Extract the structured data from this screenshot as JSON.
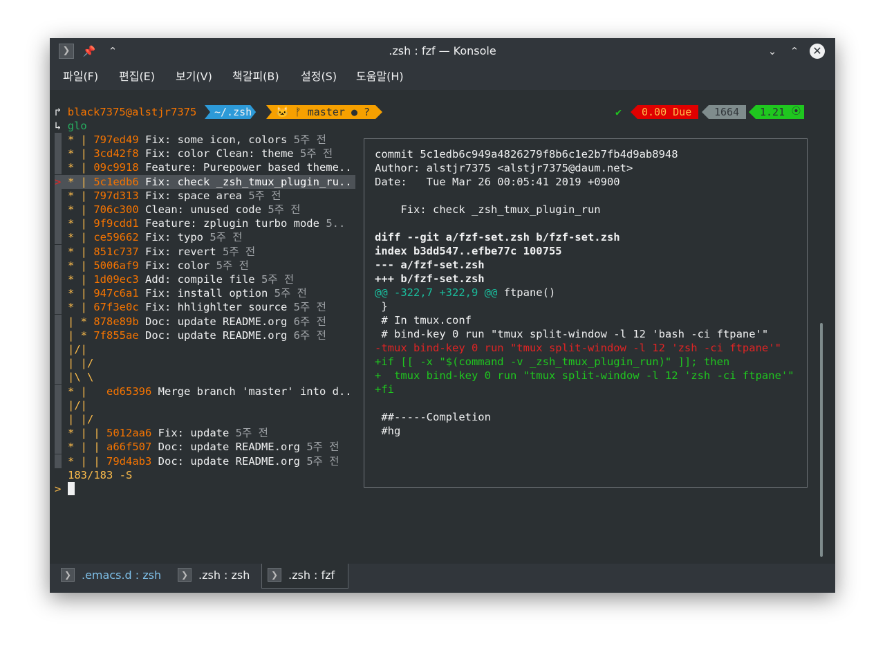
{
  "window": {
    "title": ".zsh : fzf — Konsole"
  },
  "menu": [
    "파일(F)",
    "편집(E)",
    "보기(V)",
    "책갈피(B)",
    "설정(S)",
    "도움말(H)"
  ],
  "prompt": {
    "arrow1": "↱",
    "user_host": "black7375@alstjr7375",
    "dir": "~/.zsh",
    "git": "🐱 ᚠ master ● ?",
    "check": "✔",
    "due": "0.00 Due",
    "count": "1664",
    "load": "1.21",
    "arrow2": "↳",
    "command": "glo"
  },
  "log": [
    {
      "graph": "* | ",
      "hash": "797ed49",
      "msg": "Fix: some icon, colors",
      "age": "5주 전"
    },
    {
      "graph": "* | ",
      "hash": "3cd42f8",
      "msg": "Fix: color Clean: theme",
      "age": "5주 전"
    },
    {
      "graph": "* | ",
      "hash": "09c9918",
      "msg": "Feature: Purepower based theme..",
      "age": ""
    },
    {
      "graph": "* | ",
      "hash": "5c1edb6",
      "msg": "Fix: check _zsh_tmux_plugin_ru..",
      "age": ""
    },
    {
      "graph": "* | ",
      "hash": "797d313",
      "msg": "Fix: space area",
      "age": "5주 전"
    },
    {
      "graph": "* | ",
      "hash": "706c300",
      "msg": "Clean: unused code",
      "age": "5주 전"
    },
    {
      "graph": "* | ",
      "hash": "9f9cdd1",
      "msg": "Feature: zplugin turbo mode",
      "age": "5.."
    },
    {
      "graph": "* | ",
      "hash": "ce59662",
      "msg": "Fix: typo",
      "age": "5주 전"
    },
    {
      "graph": "* | ",
      "hash": "851c737",
      "msg": "Fix: revert",
      "age": "5주 전"
    },
    {
      "graph": "* | ",
      "hash": "5006af9",
      "msg": "Fix: color",
      "age": "5주 전"
    },
    {
      "graph": "* | ",
      "hash": "1d09ec3",
      "msg": "Add: compile file",
      "age": "5주 전"
    },
    {
      "graph": "* | ",
      "hash": "947c6a1",
      "msg": "Fix: install option",
      "age": "5주 전"
    },
    {
      "graph": "* | ",
      "hash": "67f3e0c",
      "msg": "Fix: hhlighlter source",
      "age": "5주 전"
    },
    {
      "graph": "| * ",
      "hash": "878e89b",
      "msg": "Doc: update README.org",
      "age": "6주 전"
    },
    {
      "graph": "| * ",
      "hash": "7f855ae",
      "msg": "Doc: update README.org",
      "age": "6주 전"
    },
    {
      "graph": "|/|",
      "hash": "",
      "msg": "",
      "age": ""
    },
    {
      "graph": "| |/",
      "hash": "",
      "msg": "",
      "age": ""
    },
    {
      "graph": "|\\ \\",
      "hash": "",
      "msg": "",
      "age": ""
    },
    {
      "graph": "* |   ",
      "hash": "ed65396",
      "msg": "Merge branch 'master' into d..",
      "age": ""
    },
    {
      "graph": "|/|",
      "hash": "",
      "msg": "",
      "age": ""
    },
    {
      "graph": "| |/",
      "hash": "",
      "msg": "",
      "age": ""
    },
    {
      "graph": "* | | ",
      "hash": "5012aa6",
      "msg": "Fix: update",
      "age": "5주 전"
    },
    {
      "graph": "* | | ",
      "hash": "a66f507",
      "msg": "Doc: update README.org",
      "age": "5주 전"
    },
    {
      "graph": "* | | ",
      "hash": "79d4ab3",
      "msg": "Doc: update README.org",
      "age": "5주 전"
    }
  ],
  "selection_marker": ">",
  "status": "183/183 -S",
  "input_prompt": ">",
  "preview": {
    "commit": "commit 5c1edb6c949a4826279f8b6c1e2b7fb4d9ab8948",
    "author": "Author: alstjr7375 <alstjr7375@daum.net>",
    "date": "Date:   Tue Mar 26 00:05:41 2019 +0900",
    "subject": "    Fix: check _zsh_tmux_plugin_run",
    "diff_header": [
      "diff --git a/fzf-set.zsh b/fzf-set.zsh",
      "index b3dd547..efbe77c 100755",
      "--- a/fzf-set.zsh",
      "+++ b/fzf-set.zsh"
    ],
    "hunk_range": "@@ -322,7 +322,9 @@",
    "hunk_ctx": " ftpane()",
    "ctx1": " }",
    "ctx2": " # In tmux.conf",
    "ctx3": " # bind-key 0 run \"tmux split-window -l 12 'bash -ci ftpane'\"",
    "del1": "-tmux bind-key 0 run \"tmux split-window -l 12 'zsh -ci ftpane'\"",
    "add1": "+if [[ -x \"$(command -v _zsh_tmux_plugin_run)\" ]]; then",
    "add2": "+  tmux bind-key 0 run \"tmux split-window -l 12 'zsh -ci ftpane'\"",
    "add3": "+fi",
    "ctx4": " ##-----Completion",
    "ctx5": " #hg"
  },
  "tabs": [
    ".emacs.d : zsh",
    ".zsh : zsh",
    ".zsh : fzf"
  ],
  "colors": {
    "accent_orange": "#f67400",
    "graph_yellow": "#fdbc4b",
    "diff_red": "#e02424",
    "diff_green": "#1fc71f",
    "hunk_cyan": "#1abc9c"
  }
}
